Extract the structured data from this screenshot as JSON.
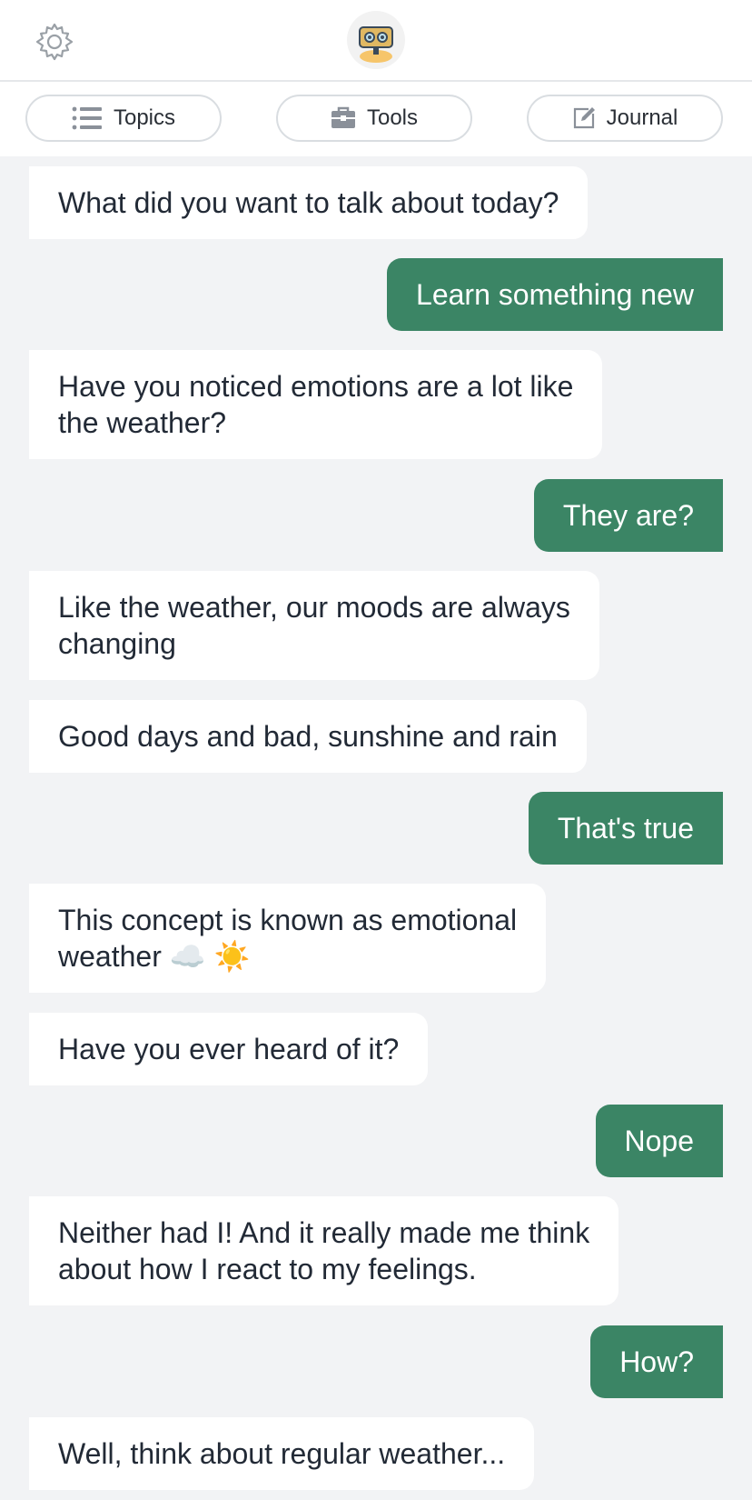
{
  "tabs": {
    "topics": "Topics",
    "tools": "Tools",
    "journal": "Journal"
  },
  "icons": {
    "settings": "gear-icon",
    "avatar": "robot-avatar-icon",
    "topics": "list-icon",
    "tools": "toolbox-icon",
    "journal": "edit-note-icon"
  },
  "colors": {
    "accent": "#3b8565",
    "background": "#f2f3f5",
    "bot_bubble": "#ffffff",
    "text": "#222a36"
  },
  "messages": [
    {
      "from": "bot",
      "text": "What did you want to talk about today?"
    },
    {
      "from": "user",
      "text": "Learn something new"
    },
    {
      "from": "bot",
      "text": "Have you noticed emotions are a lot like\nthe weather?"
    },
    {
      "from": "user",
      "text": "They are?"
    },
    {
      "from": "bot",
      "text": "Like the weather, our moods are always\nchanging"
    },
    {
      "from": "bot",
      "text": "Good days and bad, sunshine and rain"
    },
    {
      "from": "user",
      "text": "That's true"
    },
    {
      "from": "bot",
      "text": "This concept is known as emotional\nweather ☁️ ☀️"
    },
    {
      "from": "bot",
      "text": "Have you ever heard of it?"
    },
    {
      "from": "user",
      "text": "Nope"
    },
    {
      "from": "bot",
      "text": "Neither had I! And it really made me think\nabout how I react to my feelings."
    },
    {
      "from": "user",
      "text": "How?"
    },
    {
      "from": "bot",
      "text": "Well, think about regular weather..."
    }
  ]
}
